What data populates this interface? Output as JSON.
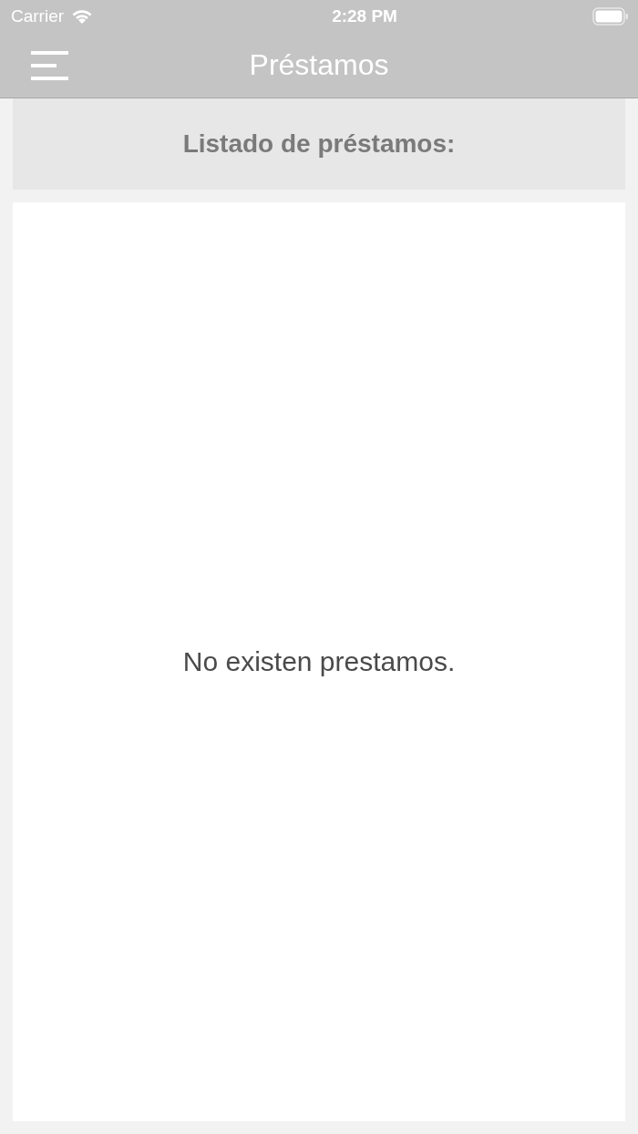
{
  "status_bar": {
    "carrier": "Carrier",
    "time": "2:28 PM"
  },
  "nav_bar": {
    "title": "Préstamos"
  },
  "header": {
    "label": "Listado de préstamos:"
  },
  "list": {
    "empty_message": "No existen prestamos."
  }
}
